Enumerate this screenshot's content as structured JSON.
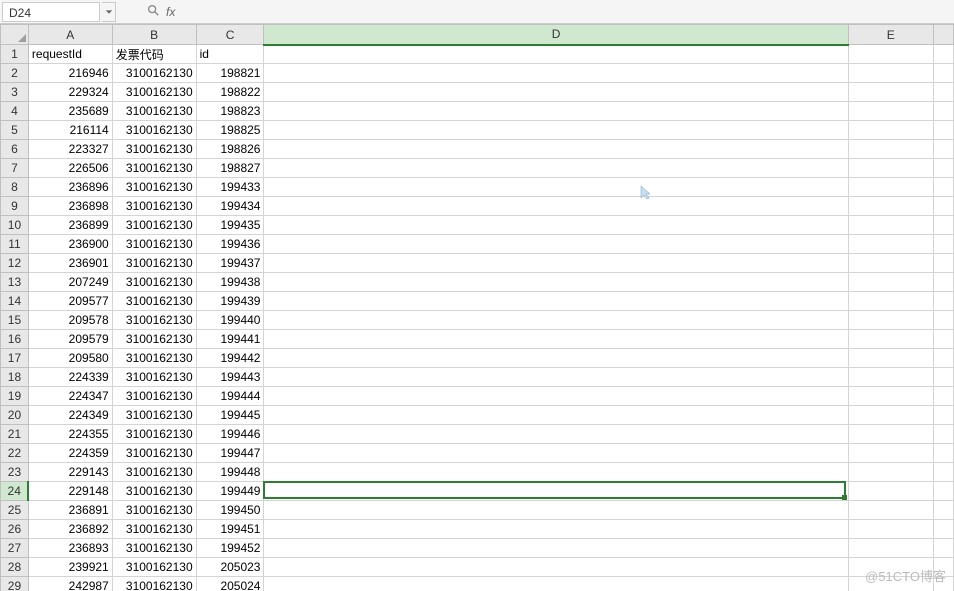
{
  "formula_bar": {
    "name_box": "D24",
    "fx_label": "fx",
    "formula_value": ""
  },
  "columns": [
    "A",
    "B",
    "C",
    "D",
    "E"
  ],
  "active_cell": "D24",
  "active_col": "D",
  "active_row": 24,
  "headers": {
    "A": "requestId",
    "B": "发票代码",
    "C": "id"
  },
  "rows": [
    {
      "n": 1,
      "A": "requestId",
      "B": "发票代码",
      "C": "id",
      "A_type": "txt",
      "B_type": "txt",
      "C_type": "txt"
    },
    {
      "n": 2,
      "A": "216946",
      "B": "3100162130",
      "C": "198821"
    },
    {
      "n": 3,
      "A": "229324",
      "B": "3100162130",
      "C": "198822"
    },
    {
      "n": 4,
      "A": "235689",
      "B": "3100162130",
      "C": "198823"
    },
    {
      "n": 5,
      "A": "216114",
      "B": "3100162130",
      "C": "198825"
    },
    {
      "n": 6,
      "A": "223327",
      "B": "3100162130",
      "C": "198826"
    },
    {
      "n": 7,
      "A": "226506",
      "B": "3100162130",
      "C": "198827"
    },
    {
      "n": 8,
      "A": "236896",
      "B": "3100162130",
      "C": "199433"
    },
    {
      "n": 9,
      "A": "236898",
      "B": "3100162130",
      "C": "199434"
    },
    {
      "n": 10,
      "A": "236899",
      "B": "3100162130",
      "C": "199435"
    },
    {
      "n": 11,
      "A": "236900",
      "B": "3100162130",
      "C": "199436"
    },
    {
      "n": 12,
      "A": "236901",
      "B": "3100162130",
      "C": "199437"
    },
    {
      "n": 13,
      "A": "207249",
      "B": "3100162130",
      "C": "199438"
    },
    {
      "n": 14,
      "A": "209577",
      "B": "3100162130",
      "C": "199439"
    },
    {
      "n": 15,
      "A": "209578",
      "B": "3100162130",
      "C": "199440"
    },
    {
      "n": 16,
      "A": "209579",
      "B": "3100162130",
      "C": "199441"
    },
    {
      "n": 17,
      "A": "209580",
      "B": "3100162130",
      "C": "199442"
    },
    {
      "n": 18,
      "A": "224339",
      "B": "3100162130",
      "C": "199443"
    },
    {
      "n": 19,
      "A": "224347",
      "B": "3100162130",
      "C": "199444"
    },
    {
      "n": 20,
      "A": "224349",
      "B": "3100162130",
      "C": "199445"
    },
    {
      "n": 21,
      "A": "224355",
      "B": "3100162130",
      "C": "199446"
    },
    {
      "n": 22,
      "A": "224359",
      "B": "3100162130",
      "C": "199447"
    },
    {
      "n": 23,
      "A": "229143",
      "B": "3100162130",
      "C": "199448"
    },
    {
      "n": 24,
      "A": "229148",
      "B": "3100162130",
      "C": "199449"
    },
    {
      "n": 25,
      "A": "236891",
      "B": "3100162130",
      "C": "199450"
    },
    {
      "n": 26,
      "A": "236892",
      "B": "3100162130",
      "C": "199451"
    },
    {
      "n": 27,
      "A": "236893",
      "B": "3100162130",
      "C": "199452"
    },
    {
      "n": 28,
      "A": "239921",
      "B": "3100162130",
      "C": "205023"
    },
    {
      "n": 29,
      "A": "242987",
      "B": "3100162130",
      "C": "205024"
    }
  ],
  "watermark": "@51CTO博客"
}
